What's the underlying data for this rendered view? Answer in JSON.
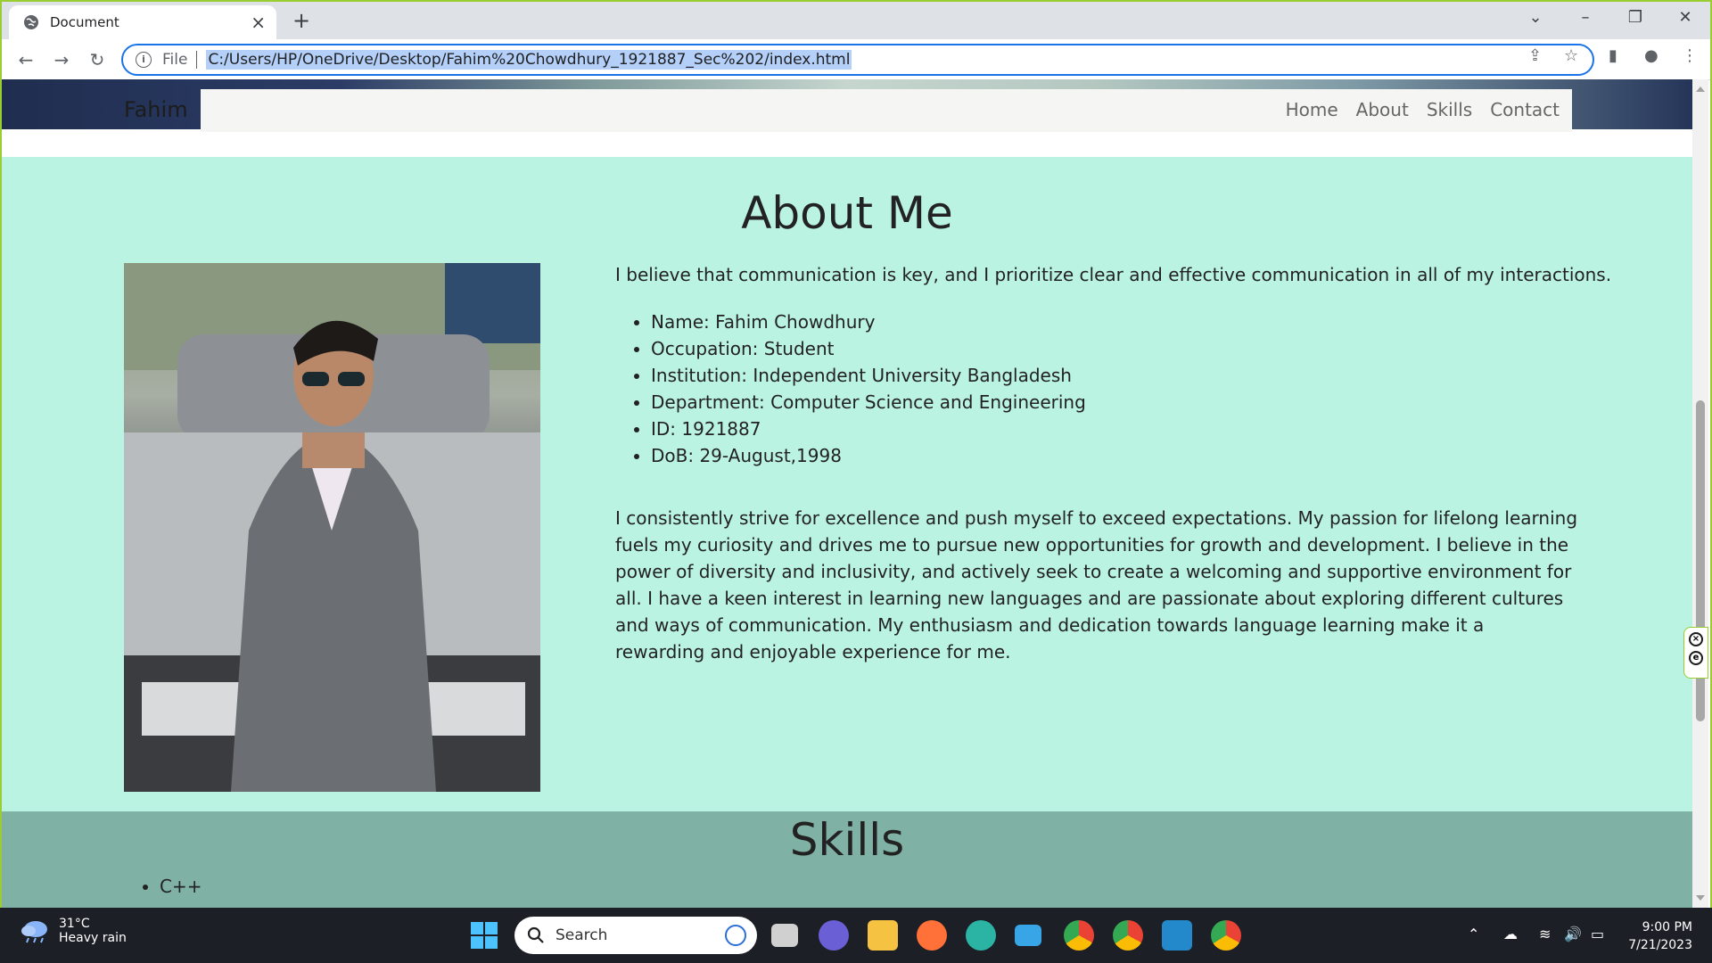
{
  "browser": {
    "tab_title": "Document",
    "url_scheme": "File",
    "url": "C:/Users/HP/OneDrive/Desktop/Fahim%20Chowdhury_1921887_Sec%202/index.html"
  },
  "page": {
    "brand": "Fahim",
    "nav": [
      "Home",
      "About",
      "Skills",
      "Contact"
    ],
    "about": {
      "heading": "About Me",
      "intro": "I believe that communication is key, and I prioritize clear and effective communication in all of my interactions.",
      "facts": [
        "Name: Fahim Chowdhury",
        "Occupation: Student",
        "Institution: Independent University Bangladesh",
        "Department: Computer Science and Engineering",
        "ID: 1921887",
        "DoB: 29-August,1998"
      ],
      "bio": "I consistently strive for excellence and push myself to exceed expectations. My passion for lifelong learning fuels my curiosity and drives me to pursue new opportunities for growth and development. I believe in the power of diversity and inclusivity, and actively seek to create a welcoming and supportive environment for all. I have a keen interest in learning new languages and are passionate about exploring different cultures and ways of communication. My enthusiasm and dedication towards language learning make it a rewarding and enjoyable experience for me."
    },
    "skills": {
      "heading": "Skills",
      "items": [
        "C++"
      ]
    }
  },
  "taskbar": {
    "weather_temp": "31°C",
    "weather_condition": "Heavy rain",
    "search_label": "Search",
    "time": "9:00 PM",
    "date": "7/21/2023"
  }
}
